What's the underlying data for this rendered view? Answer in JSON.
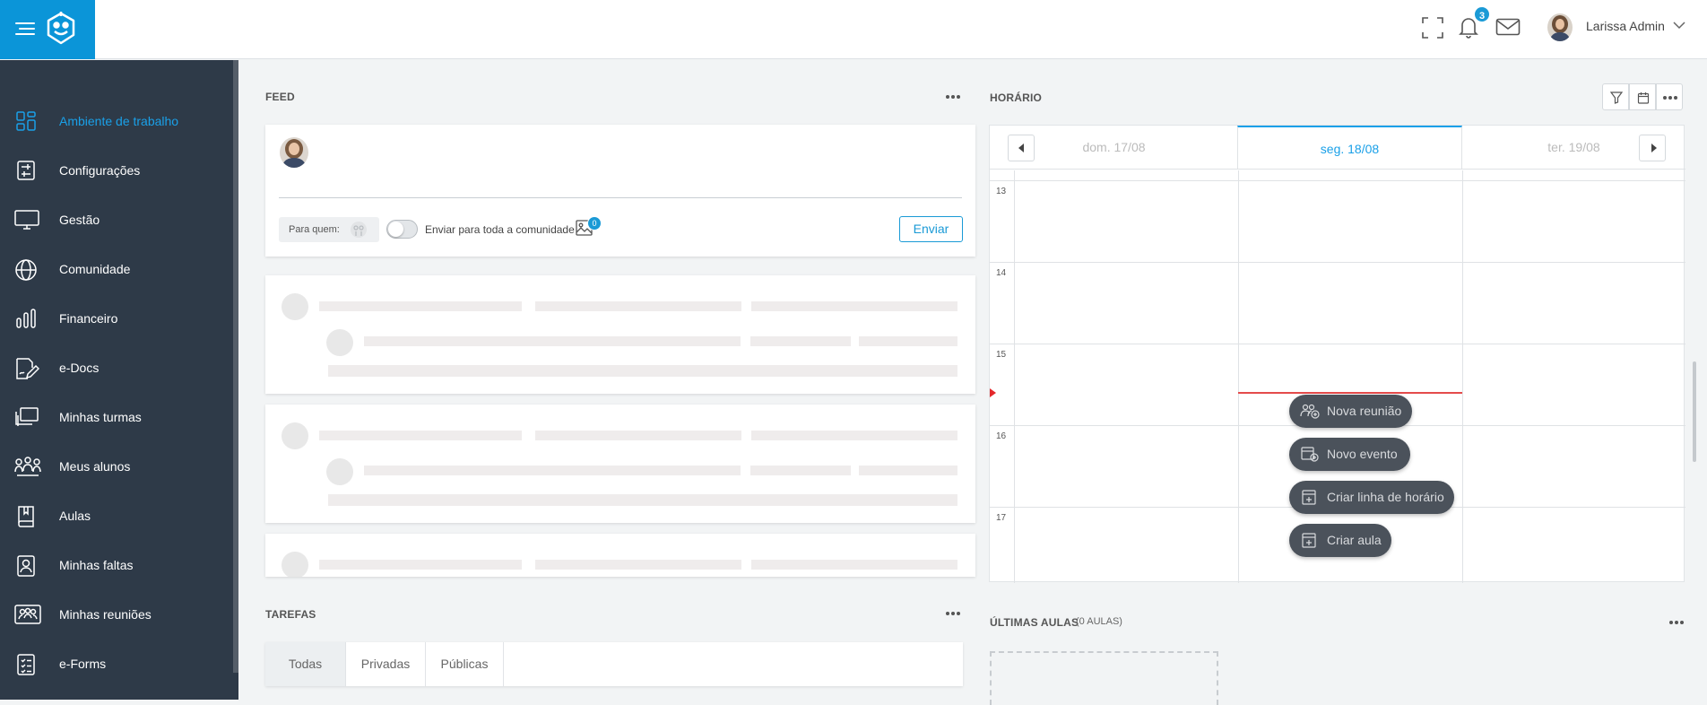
{
  "topbar": {
    "notifications_count": "3",
    "user_name": "Larissa Admin"
  },
  "sidebar": {
    "items": [
      {
        "label": "Ambiente de trabalho",
        "icon": "grid-icon",
        "active": true
      },
      {
        "label": "Configurações",
        "icon": "sliders-icon"
      },
      {
        "label": "Gestão",
        "icon": "monitor-icon"
      },
      {
        "label": "Comunidade",
        "icon": "globe-icon"
      },
      {
        "label": "Financeiro",
        "icon": "bar-chart-icon"
      },
      {
        "label": "e-Docs",
        "icon": "signature-doc-icon"
      },
      {
        "label": "Minhas turmas",
        "icon": "classes-icon"
      },
      {
        "label": "Meus alunos",
        "icon": "students-icon"
      },
      {
        "label": "Aulas",
        "icon": "book-icon"
      },
      {
        "label": "Minhas faltas",
        "icon": "absence-icon"
      },
      {
        "label": "Minhas reuniões",
        "icon": "meetings-icon"
      },
      {
        "label": "e-Forms",
        "icon": "checklist-icon"
      }
    ]
  },
  "feed": {
    "title": "FEED",
    "to_whom_label": "Para quem:",
    "toggle_label": "Enviar para toda a comunidade",
    "attachments_count": "0",
    "send_label": "Enviar"
  },
  "schedule": {
    "title": "HORÁRIO",
    "days": [
      "dom. 17/08",
      "seg. 18/08",
      "ter. 19/08"
    ],
    "active_day": 1,
    "hours": [
      "13",
      "14",
      "15",
      "16",
      "17"
    ],
    "actions": [
      "Nova reunião",
      "Novo evento",
      "Criar linha de horário",
      "Criar aula"
    ]
  },
  "tasks": {
    "title": "TAREFAS",
    "tabs": [
      "Todas",
      "Privadas",
      "Públicas"
    ]
  },
  "last_classes": {
    "title": "ÚLTIMAS AULAS",
    "subtitle": "(0 AULAS)"
  },
  "colors": {
    "brand": "#0b95d8",
    "sidebar": "#2e3a48",
    "accent": "#1aa0e8",
    "now_line": "#e44b4b"
  }
}
